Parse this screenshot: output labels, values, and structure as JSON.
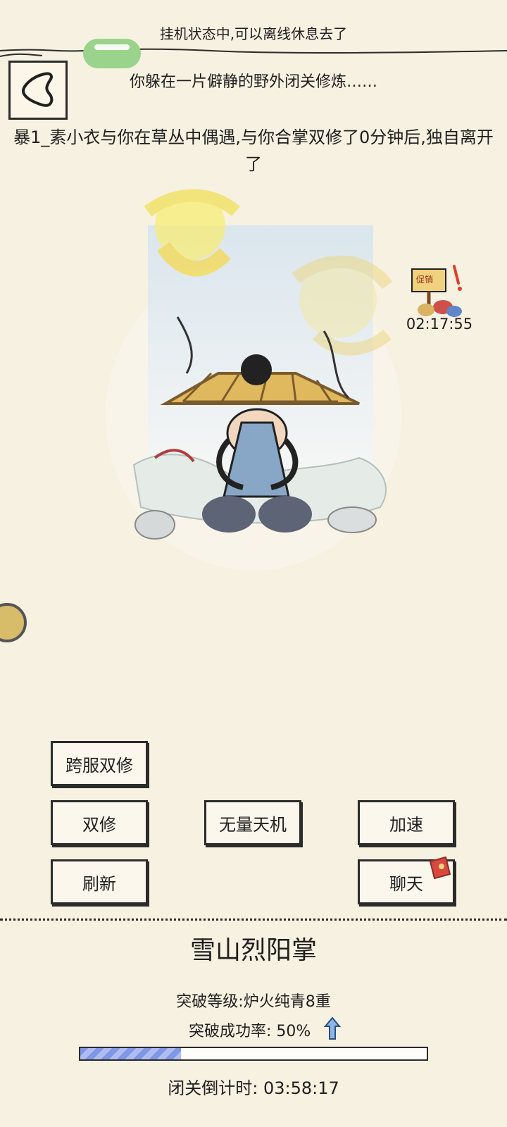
{
  "header": {
    "status": "挂机状态中,可以离线休息去了"
  },
  "messages": {
    "line1": "你躲在一片僻静的野外闭关修炼……",
    "line2": "暴1_素小衣与你在草丛中偶遇,与你合掌双修了0分钟后,独自离开了"
  },
  "promo": {
    "badge": "促销",
    "timer": "02:17:55"
  },
  "buttons": {
    "cross_server": "跨服双修",
    "dual": "双修",
    "fate": "无量天机",
    "speed": "加速",
    "refresh": "刷新",
    "chat": "聊天"
  },
  "skill": {
    "name": "雪山烈阳掌",
    "breakthrough_level": "突破等级:炉火纯青8重",
    "success_rate": "突破成功率: 50%",
    "progress": 0.29,
    "countdown": "闭关倒计时: 03:58:17"
  },
  "colors": {
    "background": "#f7f1e1",
    "ink": "#2b2b2b",
    "progress": "#7f97e5",
    "green_pill": "#9ad48c"
  }
}
